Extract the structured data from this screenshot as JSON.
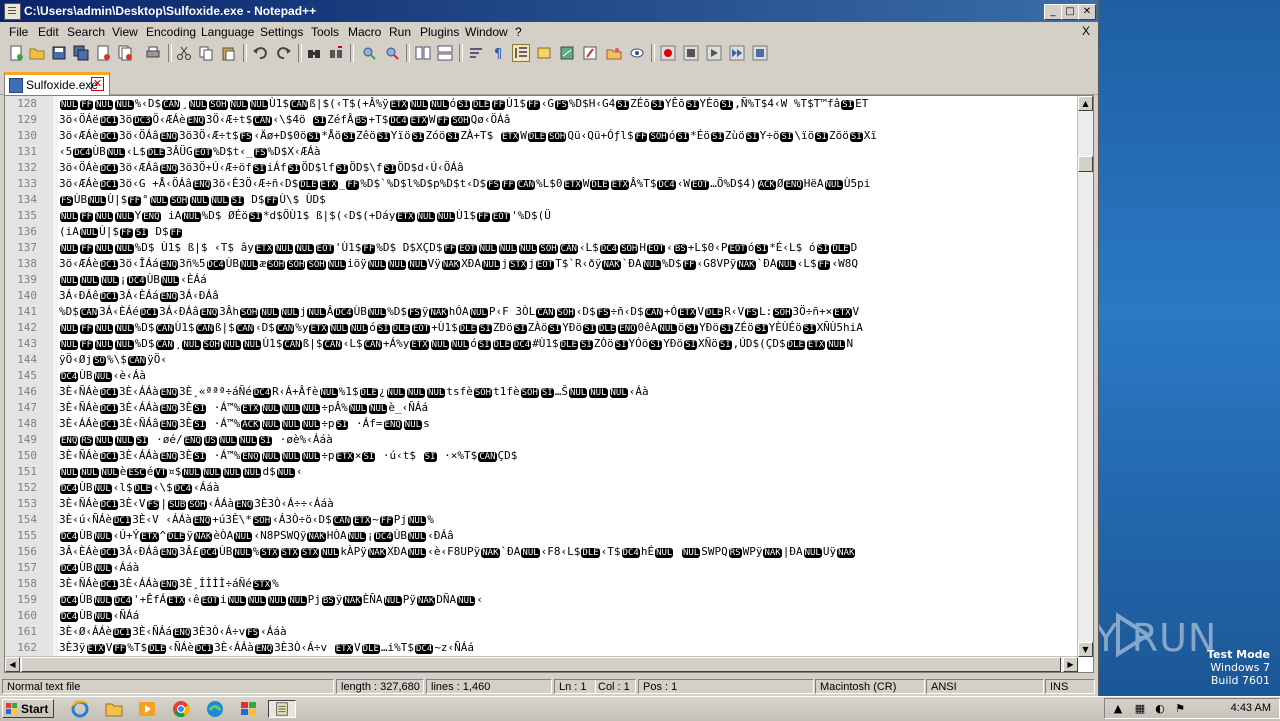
{
  "window": {
    "title": "C:\\Users\\admin\\Desktop\\Sulfoxide.exe - Notepad++",
    "minimize": "_",
    "maximize": "□",
    "close": "✕"
  },
  "menu": [
    "File",
    "Edit",
    "Search",
    "View",
    "Encoding",
    "Language",
    "Settings",
    "Tools",
    "Macro",
    "Run",
    "Plugins",
    "Window",
    "?"
  ],
  "menu_close": "X",
  "tab": {
    "label": "Sulfoxide.exe",
    "close": "✕"
  },
  "editor": {
    "lines": [
      {
        "n": "128",
        "t": "NULFFNULNUL%‹D$CAN¸NULSOHNULNULÙ1$CANß|$(‹T$(+Â%ÿETXNULNULóSIDLEFFÙ1$FF‹GFS%D$H‹G4SIZÉõSIYÊõSIYÈõSI,Ñ%T$4‹W %T$T™fâSIET"
      },
      {
        "n": "129",
        "t": "3ö‹ÖÁëDC13öDC3Ö‹ÆÁèENQ3Ö‹Æ÷t$CAN‹\\$4ö SIZéfÂBS+T$DC4ETXWFFSOHQø‹ÖÁâ"
      },
      {
        "n": "130",
        "t": "3ö‹ÆÁèDC13ö‹ÖÁâENQ3ö3Ö‹Æ÷t$FS‹Äø+D$0öSI*ÅöSIZêöSIYïöSIZóöSIZÀ+T$ ETXWDLESOHQü‹Qü+Óƒl$FFSOHóSI*ÉöSIZùöSIY÷öSI\\ïöSIZõöSIXï"
      },
      {
        "n": "131",
        "t": "‹5DC4ÙBNUL‹L$DLE3ÂÜGEOT%D$t‹_FS%D$X‹ÆÁà"
      },
      {
        "n": "132",
        "t": "3ö‹ÖÁèDC13ö‹ÆÁâENQ3ö3Ö+Ú‹Æ÷öfSIiÁfSIÖD$lfSIÖD$\\fSIÖD$d‹Ú‹ÖÁâ"
      },
      {
        "n": "133",
        "t": "3ö‹ÆÁèDC13ö‹G +Å‹ÖÁâENQ3ö‹È3Ö‹Æ÷ñ‹D$DLEETX_FF%D$`%D$l%D$p%D$t‹D$FSFFCAN%L$0ETXWDLEETXÂ%T$DC4‹WEOT…Ö%D$4)ACKØENQHëANULÙ5pi"
      },
      {
        "n": "134",
        "t": "FSÙBNULÙ|$FF°NULSOHNULNULSI D$FFÙ\\$ ÙD$"
      },
      {
        "n": "135",
        "t": "NULFFNULNULYENQ iANUL%D$ ØÉöSI*d$ÖÙ1$ ß|$(‹D$(+DáyETXNULNULÙ1$FFEOT'%D$(Ü"
      },
      {
        "n": "136",
        "t": "(iANULÙ|$FFSI D$FF"
      },
      {
        "n": "137",
        "t": "NULFFNULNUL%D$ Ù1$ ß|$ ‹T$ âyETXNULNULEOT'Ù1$FF%D$ D$XÇD$FFEOTNULNULNULSOHCAN‹L$DC4SOHHEOT‹BS+L$0‹PEOTóSI*É‹L$ óSIDLED"
      },
      {
        "n": "138",
        "t": "3ö‹ÆÁèDC13ö‹ÎÁáENQ3ñ%5DC4ÙBNULæSOHSOHSOHNULiöÿNULNULNULVÿNAKXÐANULjSTXjEOTT$`R‹ðÿNAK`ÐANUL%D$FF‹G8VPÿNAK`ÐANUL‹L$FF‹W8Q"
      },
      {
        "n": "139",
        "t": "NULNULNUL¡DC4ÙBNUL‹ÈÁá"
      },
      {
        "n": "140",
        "t": "3Á‹ÐÁêDC13Á‹ÈÁáENQ3Á‹ÐÁâ"
      },
      {
        "n": "141",
        "t": "%D$CAN3Á‹ÈÁéDC13Á‹ÐÁâENQ3ÂhSOHNULNULjNULÂDC4ÙBNUL%D$FSÿNAKhÓANULP‹F 3ÒLCANSOH‹D$FS÷ñ‹D$CAN+ÓETXVDLER‹VFSL:SOH3Ö÷ñ+×ETXV"
      },
      {
        "n": "142",
        "t": "NULFFNULNUL%D$CANÙ1$CANß|$CAN‹D$CAN%yETXNULNULóSIDLEEOT+Ù1$DLESIZÐöSIZÀöSIYÐöSIDLEENQ0êANULöSIYÐöSIZÉöSIYÈÙÉöSIXÑÙ5hiA"
      },
      {
        "n": "143",
        "t": "NULFFNULNUL%D$CAN¸NULSOHNULNULÙ1$CANß|$CAN‹L$CAN+Á%yETXNULNULóSIDLEDC4#Ù1$DLESIZÒöSIYÓöSIYÐöSIXÑöSI,ÚD$(ÇD$DLEETXNULN"
      },
      {
        "n": "144",
        "t": "ÿÖ‹ØjSO%\\$CANÿÖ‹"
      },
      {
        "n": "145",
        "t": "DC4ÙBNUL‹è‹Áà"
      },
      {
        "n": "146",
        "t": "3È‹ÑÁèDC13È‹ÁÁàENQ3È¸«ªªª÷áÑéDC4R‹Á+ÂfèNUL%1$DLE¿NULNULNULtsfèSOHt1fèSOHSI…ŠNULNULNUL‹Áà"
      },
      {
        "n": "147",
        "t": "3È‹ÑÁèDC13È‹ÁÁàENQ3ÈSI ·Á™%ETXNULNULNUL÷pÂ%NULNULè_‹ÑÁá"
      },
      {
        "n": "148",
        "t": "3È‹ÁÁèDC13È‹ÑÁâENQ3ÈSI ·Á™%ACKNULNULNUL÷pSI ·Áf=ENQNULs"
      },
      {
        "n": "149",
        "t": "ENQRSNULNULSI ·øé/ENQUSNULNULSI ·øè%‹Ááà"
      },
      {
        "n": "150",
        "t": "3È‹ÑÁèDC13È‹ÁÁàENQ3ÈSI ·Á™%ENQNULNULNUL÷pETX×SI ·ú‹t$ SI ·×%T$CANÇD$"
      },
      {
        "n": "151",
        "t": "NULNULNULèESCéVT¤$NULNULNULNULd$NUL‹"
      },
      {
        "n": "152",
        "t": "DC4ÙBNUL‹l$DLE‹\\$DC4‹Ááà"
      },
      {
        "n": "153",
        "t": "3È‹ÑÁèDC13È‹VFS|SUBSOH‹ÁÁàENQ3È3Ò‹Á÷÷‹Ááà"
      },
      {
        "n": "154",
        "t": "3È‹ú‹ÑÁèDC13È‹V ‹ÁÁàENQ+ú3È\\*SOH‹Á3Ò÷ö‹D$CANETX~FFPjNUL%"
      },
      {
        "n": "155",
        "t": "DC4ÙBNUL‹Ú+ÝETX^DLEÿNAKèÒANUL‹N8PSWQÿNAKHÒANUL¡DC4ÙBNUL‹ÐÁâ"
      },
      {
        "n": "156",
        "t": "3Â‹ÈÁèDC13Â‹ÐÁâENQ3Â£DC4ÙBNUL%STXSTXSTXNULkÀPÿNAKXÐANUL‹è‹F8UPÿNAK`ÐANUL‹F8‹L$DLE‹T$DC4hÉNUL NULSWPQRSWPÿNAK|ÐANULUÿNAK"
      },
      {
        "n": "157",
        "t": "DC4ÙBNUL‹Ááà"
      },
      {
        "n": "158",
        "t": "3È‹ÑÁèDC13È‹ÁÁàENQ3È¸ÍÌÌÌ÷áÑéSTX%"
      },
      {
        "n": "159",
        "t": "DC4ÙBNULDC4'+ÊfÁETX‹êEOTiNULNULNULNULPjBSÿNAKÈÑANULPÿNAKDÑANUL‹"
      },
      {
        "n": "160",
        "t": "DC4ÙBNUL‹ÑÁá"
      },
      {
        "n": "161",
        "t": "3È‹Ø‹ÁÁèDC13È‹ÑÁáENQ3È3Ò‹Á÷vFS‹Ááà"
      },
      {
        "n": "162",
        "t": "3È3ÿETXVFF%T$DLE‹ÑÁèDC13È‹ÁÁàENQ3È3Ò‹Á÷v ETXVDLE…i%T$DC4~z‹ÑÁá"
      }
    ]
  },
  "status": {
    "type": "Normal text file",
    "length": "length : 327,680",
    "lines": "lines : 1,460",
    "ln": "Ln : 1",
    "col": "Col : 1",
    "pos": "Pos : 1",
    "eol": "Macintosh (CR)",
    "encoding": "ANSI",
    "ins": "INS"
  },
  "taskbar": {
    "start": "Start",
    "clock": "4:43 AM"
  },
  "watermark": {
    "text": "ANY RUN"
  },
  "testmode": {
    "line1": "Test Mode",
    "line2": "Windows 7",
    "line3": "Build 7601"
  }
}
